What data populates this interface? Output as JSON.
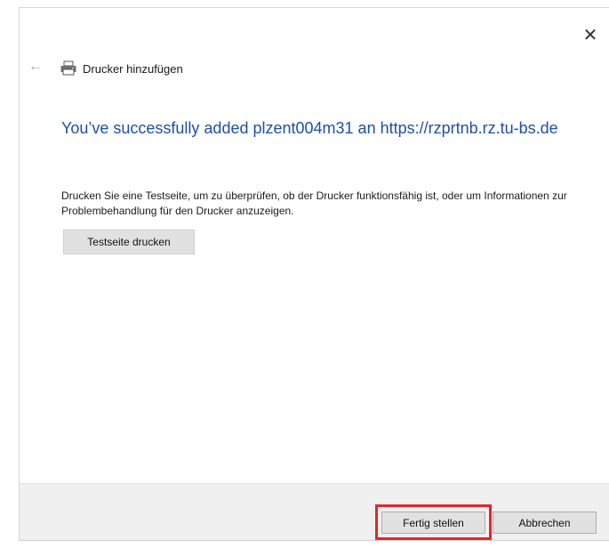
{
  "window": {
    "title": "Drucker hinzufügen",
    "close_icon": "close-icon",
    "back_icon": "back-arrow-icon",
    "printer_icon": "printer-icon"
  },
  "main": {
    "heading": "You’ve successfully added plzent004m31 an https://rzprtnb.rz.tu-bs.de",
    "description": "Drucken Sie eine Testseite, um zu überprüfen, ob der Drucker funktionsfähig ist, oder um Informationen zur Problembehandlung für den Drucker anzuzeigen.",
    "test_button_label": "Testseite drucken"
  },
  "footer": {
    "finish_label": "Fertig stellen",
    "cancel_label": "Abbrechen"
  },
  "colors": {
    "heading": "#1f4fa8",
    "highlight": "#e3262d",
    "footer_bg": "#f0f0f0",
    "button_bg": "#e1e1e1"
  }
}
